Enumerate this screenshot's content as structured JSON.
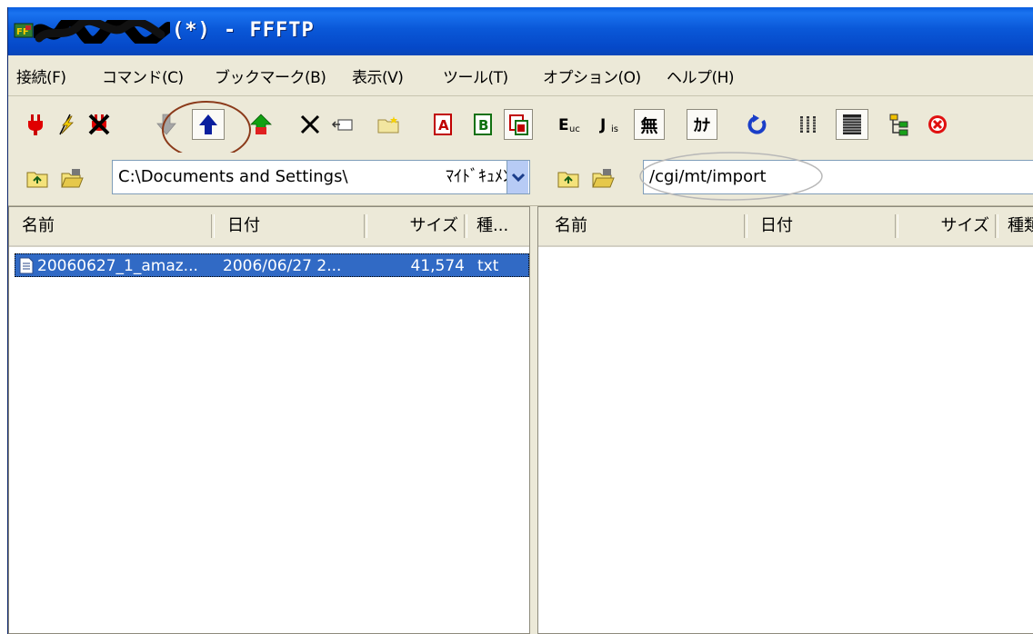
{
  "window": {
    "title": "(*) - FFFTP"
  },
  "menu": [
    "接続(F)",
    "コマンド(C)",
    "ブックマーク(B)",
    "表示(V)",
    "ツール(T)",
    "オプション(O)",
    "ヘルプ(H)"
  ],
  "toolbar": {
    "icons": [
      "connect-icon",
      "quick-connect-icon",
      "disconnect-icon",
      "download-icon",
      "upload-icon",
      "mirror-upload-icon",
      "delete-icon",
      "rename-icon",
      "mkdir-icon",
      "ascii-mode-icon",
      "binary-mode-icon",
      "auto-mode-icon",
      "euc-icon",
      "jis-icon",
      "no-convert-icon",
      "kana-convert-icon",
      "refresh-icon",
      "list-view-icon",
      "detail-view-icon",
      "tree-icon",
      "stop-icon"
    ],
    "text": {
      "euc": "E",
      "euc_sub": "uc",
      "jis": "J",
      "jis_sub": "is",
      "nocvt": "無",
      "kana": "ｶﾅ",
      "ascii": "A",
      "binary": "B"
    }
  },
  "local": {
    "path": "C:\\Documents and Settings\\",
    "path_tail": "ﾏｲﾄﾞｷｭﾒﾝﾄ",
    "columns": [
      "名前",
      "日付",
      "サイズ",
      "種..."
    ],
    "files": [
      {
        "name": "20060627_1_amaz...",
        "date": "2006/06/27 2...",
        "size": "41,574",
        "type": "txt"
      }
    ]
  },
  "remote": {
    "path": "/cgi/mt/import",
    "columns": [
      "名前",
      "日付",
      "サイズ",
      "種類"
    ],
    "files": []
  },
  "colors": {
    "titlebar": "#0a58d8",
    "selection": "#316ac5",
    "chrome": "#ece9d8",
    "annotation": "#8b3a1a"
  }
}
